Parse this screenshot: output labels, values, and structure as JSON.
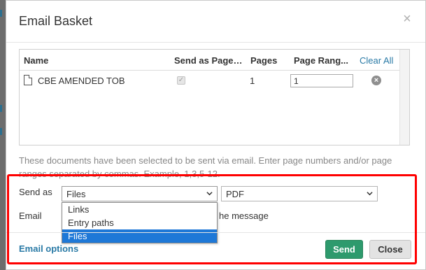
{
  "dialog": {
    "title": "Email Basket"
  },
  "grid": {
    "columns": {
      "name": "Name",
      "send_as": "Send as Pages...",
      "pages": "Pages",
      "page_range": "Page Rang...",
      "clear_all": "Clear All"
    },
    "rows": [
      {
        "name": "CBE AMENDED TOB",
        "pages": "1",
        "page_range": "1"
      }
    ]
  },
  "help_text": "These documents have been selected to be sent via email. Enter page numbers and/or page ranges separated by commas. Example, 1,3,5-12.",
  "form": {
    "send_as_label": "Send as",
    "send_as_value": "Files",
    "format_value": "PDF",
    "email_label": "Email",
    "message_fragment": "he message",
    "send_as_options": [
      "Links",
      "Entry paths",
      "Files"
    ]
  },
  "footer": {
    "email_options": "Email options",
    "send": "Send",
    "close": "Close"
  },
  "colors": {
    "accent_link": "#2a7aa6",
    "send_button": "#2e9a6d",
    "highlight": "#ff0000",
    "selected_option": "#1e78d7"
  }
}
